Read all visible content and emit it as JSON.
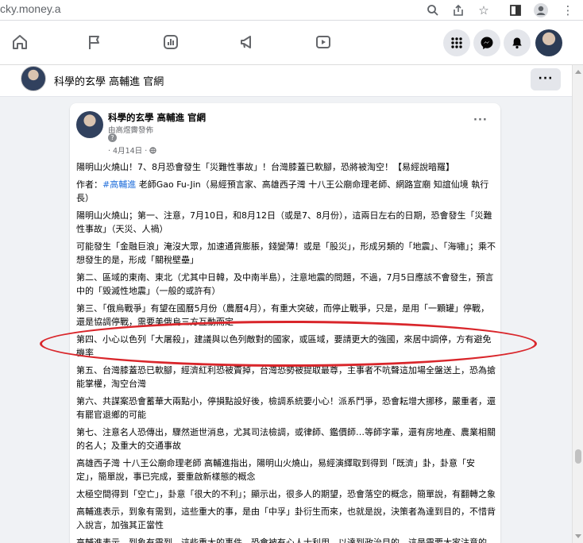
{
  "browser": {
    "url": "cky.money.a"
  },
  "page": {
    "name": "科學的玄學 高輔進 官網"
  },
  "post": {
    "author": "科學的玄學 高輔進 官網",
    "published_by": "由高煜霽發佈",
    "date": "· 4月14日 ·",
    "paragraphs": [
      {
        "text": "陽明山火燒山！7、8月恐會發生「災難性事故」！台灣膝蓋已軟腳，恐將被淘空！【易經說暗羅】"
      },
      {
        "prefix": "作者：",
        "tag": "#高輔進",
        "text": " 老師Gao Fu-Jin（易經預言家、高雄西子灣 十八王公廟命理老師、網路宣廟 知誼仙境 執行長）"
      },
      {
        "text": "陽明山火燒山；第一、注意，7月10日，和8月12日（或是7、8月份），這兩日左右的日期，恐會發生「災難性事故」（天災、人禍）"
      },
      {
        "text": "可能發生「金融巨浪」淹沒大眾，加速通貨膨脹，錢變薄！或是「股災」，形成另類的「地震」、「海嘯」；乘不想發生的是，形成「關稅壁壘」"
      },
      {
        "text": "第二、區域的東南、東北（尤其中日韓，及中南半島），注意地震的問題，不過，7月5日應該不會發生，預言中的「毀滅性地震」（一般的或許有）"
      },
      {
        "text": "第三、「俄烏戰爭」有望在國曆5月份（農曆4月），有重大突破，而停止戰爭，只是，是用「一顆罐」停戰，還是協調停戰，需要美俄烏三方互動而定"
      },
      {
        "text": "第四、小心以色列「大屠殺」，建議與以色列敵對的國家，或區域，要請更大的強國，來居中調停，方有避免機率"
      },
      {
        "text": "第五、台灣膝蓋恐已軟腳，經濟紅利恐被賣掉，台灣恐勢被提取最尊，主事者不吭聲這加場全盤送上，恐為搶能掌權，淘空台灣"
      },
      {
        "text": "第六、共謀案恐會蓄華大兩點小，停損點設好後，檢調系統要小心！派系鬥爭，恐會耘增大挪移，嚴重者，還有罷官退鄉的可能"
      },
      {
        "text": "第七、注意名人恐傳出，驟然逝世消息，尤其司法檢調，或律師、鑑價師…等師字輩，還有房地產、農業相關的名人；及重大的交通事故"
      },
      {
        "text": "高雄西子灣 十八王公廟命理老師 高輔進指出，陽明山火燒山，易經演繹取到得到「既濟」卦，卦意「安定」，簡單說，事已完成，要重啟新樣態的概念"
      },
      {
        "text": "太極空間得到「空亡」，卦意「很大的不利」；顯示出，很多人的期望，恐會落空的概念，簡單說，有翻轉之象"
      },
      {
        "text": "高輔進表示，到象有需到，這些重大的事，是由「中孚」卦衍生而來，也就是說，決策者為達到目的，不惜背入說言，加強其正當性"
      },
      {
        "text": "高輔進表示，到象有需到，這些重大的事件，恐會被有心人士利用，以達到政治目的，這是需要大家注意的",
        "clip": true
      }
    ]
  }
}
